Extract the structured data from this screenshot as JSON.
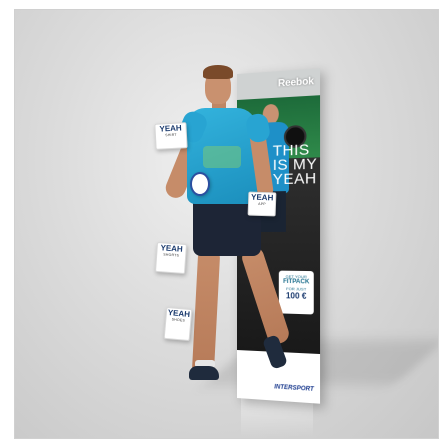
{
  "banner": {
    "brand_logo": "Reebok",
    "slogan_lines": [
      "THIS",
      "IS MY",
      "YEAH"
    ],
    "promo": {
      "line1": "GET YOUR",
      "line2": "FITPACK",
      "line3": "FOR JUST",
      "price": "100 €"
    },
    "retailer_part1": "INTER",
    "retailer_part2": "SPORT"
  },
  "tags": [
    {
      "main": "YEAH",
      "sub": "SHIRT"
    },
    {
      "main": "YEAH",
      "sub": "APP"
    },
    {
      "main": "YEAH",
      "sub": "SHORTS"
    },
    {
      "main": "YEAH",
      "sub": "SHOES"
    }
  ],
  "colors": {
    "shirt": "#28a4d2",
    "banner_green": "#2f8a4a",
    "brand_blue": "#1a3a6e",
    "retailer_red": "#e3001b"
  }
}
